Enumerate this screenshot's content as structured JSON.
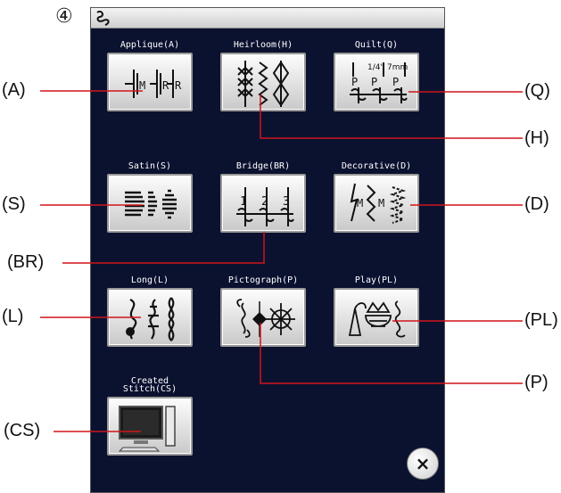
{
  "step_marker": "④",
  "screen": {
    "categories": [
      {
        "id": "A",
        "label": "Applique(A)"
      },
      {
        "id": "H",
        "label": "Heirloom(H)"
      },
      {
        "id": "Q",
        "label": "Quilt(Q)"
      },
      {
        "id": "S",
        "label": "Satin(S)"
      },
      {
        "id": "BR",
        "label": "Bridge(BR)"
      },
      {
        "id": "D",
        "label": "Decorative(D)"
      },
      {
        "id": "L",
        "label": "Long(L)"
      },
      {
        "id": "P",
        "label": "Pictograph(P)"
      },
      {
        "id": "PL",
        "label": "Play(PL)"
      },
      {
        "id": "CS",
        "label_line1": "Created",
        "label_line2": "Stitch(CS)"
      }
    ],
    "close_glyph": "×",
    "icon_text": {
      "applique_m": "M",
      "applique_r": "R",
      "quilt_1_4": "1/4\"",
      "quilt_7mm": "7mm",
      "quilt_p": "P",
      "bridge_1": "1",
      "bridge_2": "2",
      "bridge_3": "3",
      "decorative_m": "M"
    }
  },
  "callouts": {
    "A": "(A)",
    "H": "(H)",
    "Q": "(Q)",
    "S": "(S)",
    "BR": "(BR)",
    "D": "(D)",
    "L": "(L)",
    "P": "(P)",
    "PL": "(PL)",
    "CS": "(CS)"
  },
  "colors": {
    "screen_bg": "#0b1230",
    "callout_line": "#d0141a",
    "label_text": "#ffffff"
  }
}
